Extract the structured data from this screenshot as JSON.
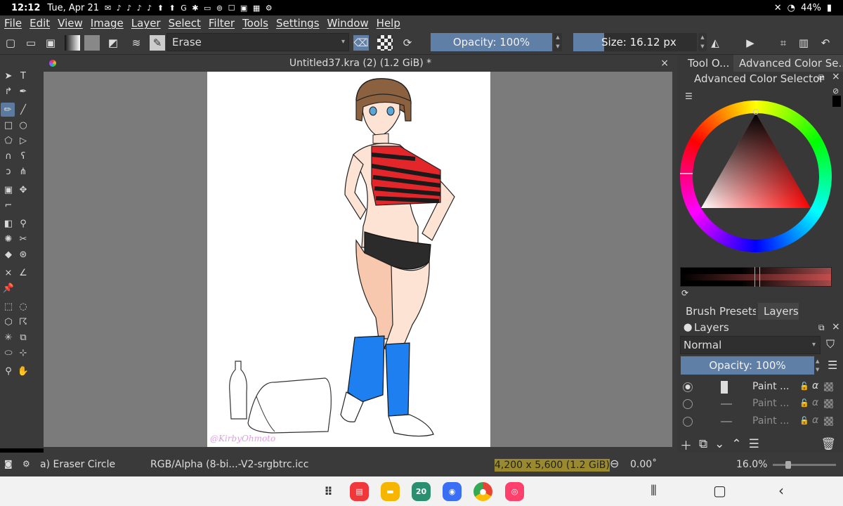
{
  "status": {
    "time": "12:12",
    "date": "Tue, Apr 21",
    "battery": "44%"
  },
  "menu": [
    "File",
    "Edit",
    "View",
    "Image",
    "Layer",
    "Select",
    "Filter",
    "Tools",
    "Settings",
    "Window",
    "Help"
  ],
  "toolbar": {
    "preset_name": "Erase",
    "opacity_label": "Opacity: 100%",
    "opacity_value": 1.0,
    "size_label": "Size: 16.12 px"
  },
  "document": {
    "title": "Untitled37.kra (2) (1.2 GiB) *",
    "watermark": "@KirbyOhmoto"
  },
  "dock": {
    "tab_tool_options": "Tool O...",
    "tab_color": "Advanced Color Se...",
    "color_title": "Advanced Color Selector",
    "tab_brush_presets": "Brush Presets",
    "tab_layers": "Layers",
    "layers_title": "Layers",
    "blend_mode": "Normal",
    "layer_opacity": "Opacity:  100%",
    "layers": [
      {
        "name": "Paint ...",
        "alpha": "α",
        "visible": true
      },
      {
        "name": "Paint ...",
        "alpha": "α",
        "visible": false
      },
      {
        "name": "Paint ...",
        "alpha": "α",
        "visible": false
      }
    ]
  },
  "statusbar": {
    "brush": "a) Eraser Circle",
    "colorspace": "RGB/Alpha (8-bi...-V2-srgbtrc.icc",
    "dimensions": "4,200 x 5,600 (1.2 GiB)",
    "rotation": "0.00˚",
    "zoom": "16.0%"
  },
  "colors": {
    "accent": "#5f7fa6",
    "panel": "#3a3a3a",
    "canvas_bg": "#7b7b7b"
  },
  "icons": {
    "close": "×",
    "arrow_down": "▾"
  },
  "nav_apps": [
    {
      "name": "app-drawer-icon",
      "color": "#f2f2f2"
    },
    {
      "name": "flexcil-app-icon",
      "color": "#f2373a"
    },
    {
      "name": "files-app-icon",
      "color": "#f6b500"
    },
    {
      "name": "calendar-app-icon",
      "color": "#2a8f6e",
      "label": "20"
    },
    {
      "name": "messages-app-icon",
      "color": "#3a6ff5"
    },
    {
      "name": "chrome-app-icon",
      "color": "#34a853"
    },
    {
      "name": "screen-recorder-app-icon",
      "color": "#ff3f6c"
    }
  ]
}
